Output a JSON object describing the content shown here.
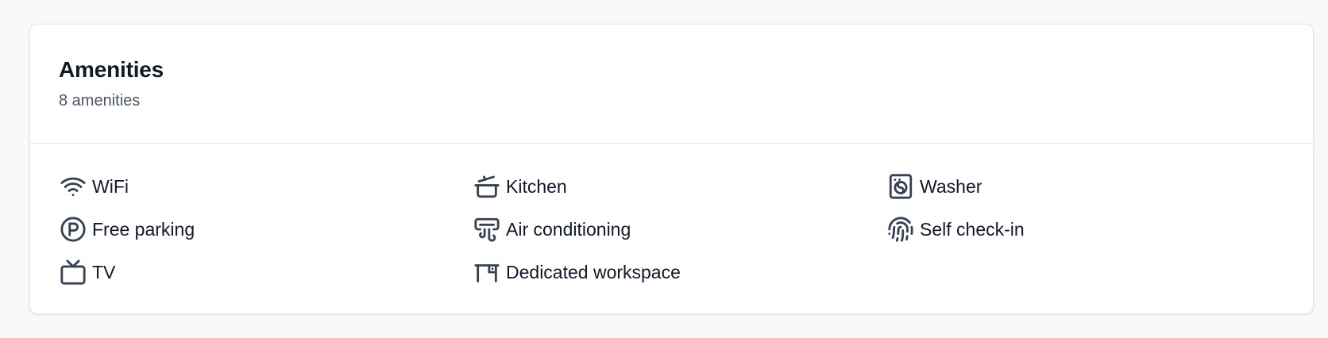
{
  "amenities_card": {
    "title": "Amenities",
    "subtitle": "8 amenities",
    "items": [
      {
        "label": "WiFi",
        "icon": "wifi-icon"
      },
      {
        "label": "Kitchen",
        "icon": "cooking-pot-icon"
      },
      {
        "label": "Washer",
        "icon": "washing-machine-icon"
      },
      {
        "label": "Free parking",
        "icon": "parking-icon"
      },
      {
        "label": "Air conditioning",
        "icon": "air-conditioner-icon"
      },
      {
        "label": "Self check-in",
        "icon": "fingerprint-icon"
      },
      {
        "label": "TV",
        "icon": "tv-icon"
      },
      {
        "label": "Dedicated workspace",
        "icon": "desk-icon"
      }
    ]
  },
  "colors": {
    "page_background": "#f8f9fb",
    "card_background": "#ffffff",
    "border": "#e5e7eb",
    "text_primary": "#111827",
    "text_secondary": "#4b5563",
    "icon": "#374151"
  }
}
